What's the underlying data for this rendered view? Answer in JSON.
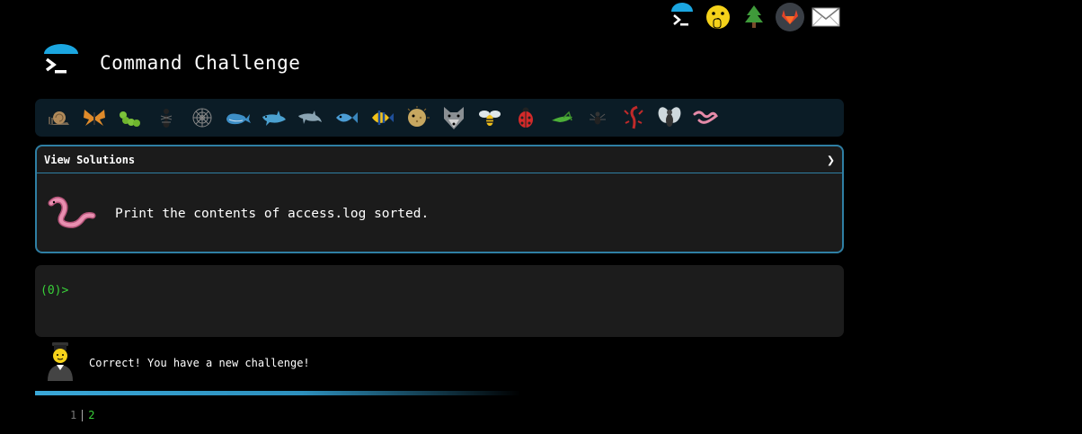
{
  "topbar": {
    "icons": [
      "terminal-icon",
      "hushed-face-icon",
      "tree-icon",
      "gitlab-icon",
      "mail-icon"
    ]
  },
  "header": {
    "title": "Command Challenge"
  },
  "animals": [
    "snail",
    "butterfly",
    "caterpillar",
    "ant",
    "spider-web",
    "whale",
    "shark",
    "dolphin",
    "fish",
    "tropical-fish",
    "pufferfish",
    "wolf",
    "bee",
    "ladybug",
    "grasshopper",
    "spider",
    "scorpion",
    "fly",
    "worm"
  ],
  "panel": {
    "header_label": "View Solutions",
    "chevron": "❯",
    "challenge_text": "Print the contents of access.log sorted."
  },
  "terminal": {
    "prompt": "(0)>"
  },
  "feedback": {
    "message": "Correct! You have a new challenge!"
  },
  "pager": {
    "page1": "1",
    "page2": "2"
  },
  "colors": {
    "accent": "#2f7fa4",
    "prompt": "#39d139",
    "strip": "#0b1c26"
  }
}
